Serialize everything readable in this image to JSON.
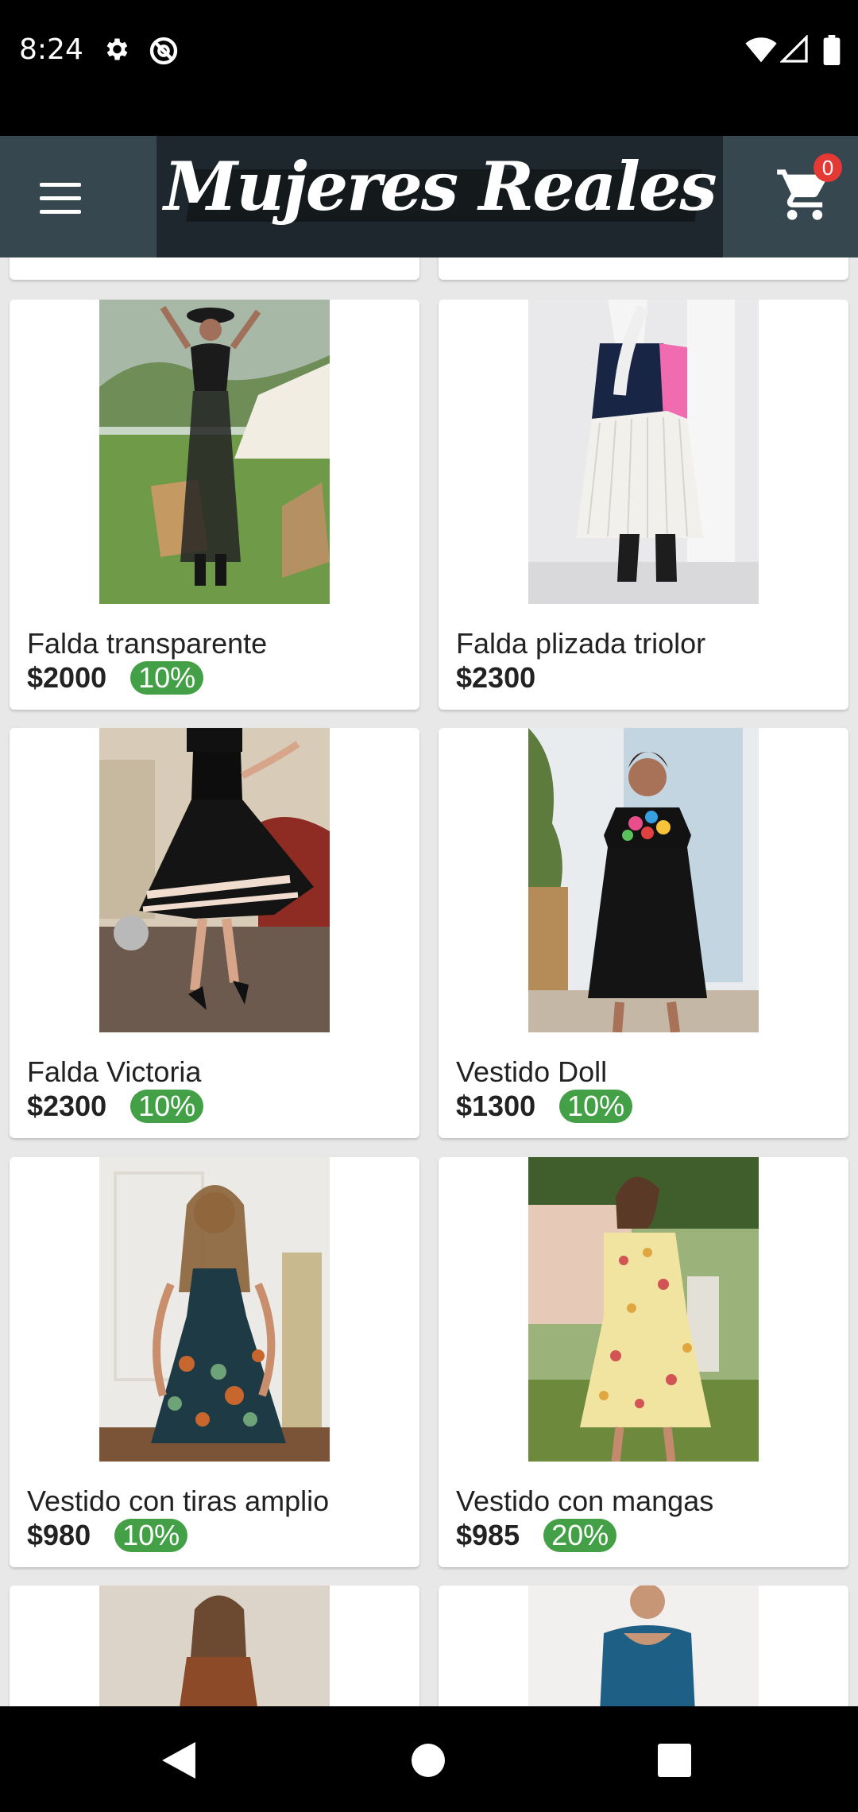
{
  "status_bar": {
    "time": "8:24",
    "icons": [
      "settings-icon",
      "at-sign-icon",
      "wifi-icon",
      "signal-icon",
      "battery-icon"
    ]
  },
  "app_bar": {
    "logo_text": "Mujeres Reales",
    "cart_count": "0",
    "icons": [
      "menu-icon",
      "cart-icon"
    ]
  },
  "products": [
    {
      "title": "Falda transparente",
      "price": "$2000",
      "discount": "10%"
    },
    {
      "title": "Falda plizada triolor",
      "price": "$2300"
    },
    {
      "title": "Falda Victoria",
      "price": "$2300",
      "discount": "10%"
    },
    {
      "title": "Vestido Doll",
      "price": "$1300",
      "discount": "10%"
    },
    {
      "title": "Vestido con tiras amplio",
      "price": "$980",
      "discount": "10%"
    },
    {
      "title": "Vestido con mangas",
      "price": "$985",
      "discount": "20%"
    }
  ],
  "colors": {
    "app_bar": "#37474f",
    "discount_badge": "#43a047",
    "cart_badge": "#e53935"
  },
  "nav_bar": {
    "icons": [
      "back-icon",
      "home-icon",
      "recents-icon"
    ]
  }
}
